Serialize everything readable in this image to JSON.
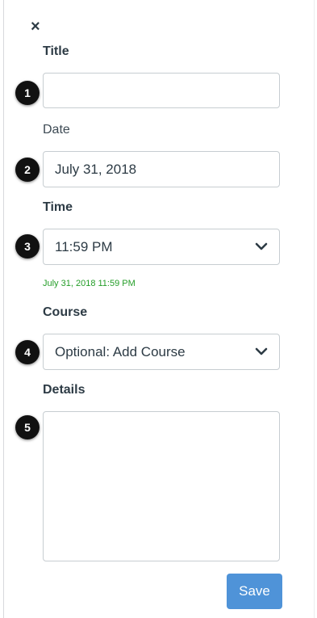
{
  "close": {
    "glyph": "×"
  },
  "title": {
    "label": "Title",
    "value": "",
    "step": "1"
  },
  "date": {
    "label": "Date",
    "value": "July 31, 2018",
    "step": "2"
  },
  "time": {
    "label": "Time",
    "value": "11:59 PM",
    "step": "3",
    "hint": "July 31, 2018 11:59 PM"
  },
  "course": {
    "label": "Course",
    "value": "Optional: Add Course",
    "step": "4"
  },
  "details": {
    "label": "Details",
    "value": "",
    "step": "5"
  },
  "save": {
    "label": "Save"
  },
  "icons": {
    "close": "close-icon",
    "dropdown": "chevron-down-icon"
  },
  "colors": {
    "save_button": "#4f93d8",
    "hint_text": "#239d27",
    "badge": "#111111"
  }
}
